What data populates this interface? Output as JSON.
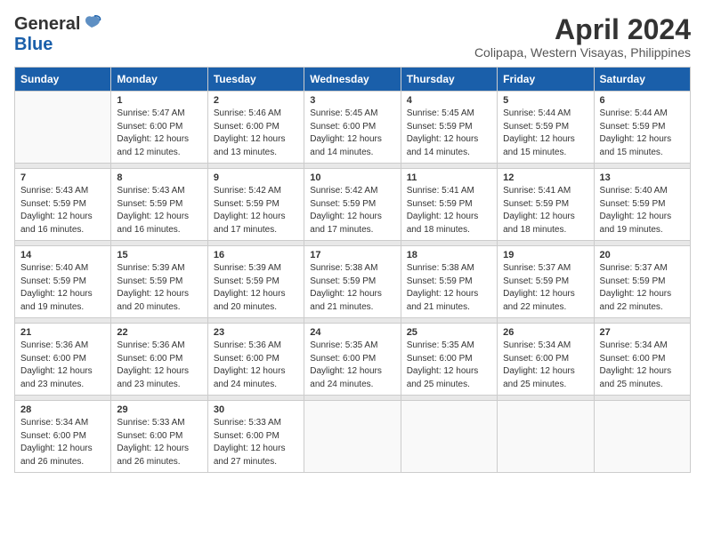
{
  "header": {
    "logo_general": "General",
    "logo_blue": "Blue",
    "title": "April 2024",
    "location": "Colipapa, Western Visayas, Philippines"
  },
  "calendar": {
    "days_of_week": [
      "Sunday",
      "Monday",
      "Tuesday",
      "Wednesday",
      "Thursday",
      "Friday",
      "Saturday"
    ],
    "weeks": [
      [
        {
          "num": "",
          "info": ""
        },
        {
          "num": "1",
          "info": "Sunrise: 5:47 AM\nSunset: 6:00 PM\nDaylight: 12 hours\nand 12 minutes."
        },
        {
          "num": "2",
          "info": "Sunrise: 5:46 AM\nSunset: 6:00 PM\nDaylight: 12 hours\nand 13 minutes."
        },
        {
          "num": "3",
          "info": "Sunrise: 5:45 AM\nSunset: 6:00 PM\nDaylight: 12 hours\nand 14 minutes."
        },
        {
          "num": "4",
          "info": "Sunrise: 5:45 AM\nSunset: 5:59 PM\nDaylight: 12 hours\nand 14 minutes."
        },
        {
          "num": "5",
          "info": "Sunrise: 5:44 AM\nSunset: 5:59 PM\nDaylight: 12 hours\nand 15 minutes."
        },
        {
          "num": "6",
          "info": "Sunrise: 5:44 AM\nSunset: 5:59 PM\nDaylight: 12 hours\nand 15 minutes."
        }
      ],
      [
        {
          "num": "7",
          "info": "Sunrise: 5:43 AM\nSunset: 5:59 PM\nDaylight: 12 hours\nand 16 minutes."
        },
        {
          "num": "8",
          "info": "Sunrise: 5:43 AM\nSunset: 5:59 PM\nDaylight: 12 hours\nand 16 minutes."
        },
        {
          "num": "9",
          "info": "Sunrise: 5:42 AM\nSunset: 5:59 PM\nDaylight: 12 hours\nand 17 minutes."
        },
        {
          "num": "10",
          "info": "Sunrise: 5:42 AM\nSunset: 5:59 PM\nDaylight: 12 hours\nand 17 minutes."
        },
        {
          "num": "11",
          "info": "Sunrise: 5:41 AM\nSunset: 5:59 PM\nDaylight: 12 hours\nand 18 minutes."
        },
        {
          "num": "12",
          "info": "Sunrise: 5:41 AM\nSunset: 5:59 PM\nDaylight: 12 hours\nand 18 minutes."
        },
        {
          "num": "13",
          "info": "Sunrise: 5:40 AM\nSunset: 5:59 PM\nDaylight: 12 hours\nand 19 minutes."
        }
      ],
      [
        {
          "num": "14",
          "info": "Sunrise: 5:40 AM\nSunset: 5:59 PM\nDaylight: 12 hours\nand 19 minutes."
        },
        {
          "num": "15",
          "info": "Sunrise: 5:39 AM\nSunset: 5:59 PM\nDaylight: 12 hours\nand 20 minutes."
        },
        {
          "num": "16",
          "info": "Sunrise: 5:39 AM\nSunset: 5:59 PM\nDaylight: 12 hours\nand 20 minutes."
        },
        {
          "num": "17",
          "info": "Sunrise: 5:38 AM\nSunset: 5:59 PM\nDaylight: 12 hours\nand 21 minutes."
        },
        {
          "num": "18",
          "info": "Sunrise: 5:38 AM\nSunset: 5:59 PM\nDaylight: 12 hours\nand 21 minutes."
        },
        {
          "num": "19",
          "info": "Sunrise: 5:37 AM\nSunset: 5:59 PM\nDaylight: 12 hours\nand 22 minutes."
        },
        {
          "num": "20",
          "info": "Sunrise: 5:37 AM\nSunset: 5:59 PM\nDaylight: 12 hours\nand 22 minutes."
        }
      ],
      [
        {
          "num": "21",
          "info": "Sunrise: 5:36 AM\nSunset: 6:00 PM\nDaylight: 12 hours\nand 23 minutes."
        },
        {
          "num": "22",
          "info": "Sunrise: 5:36 AM\nSunset: 6:00 PM\nDaylight: 12 hours\nand 23 minutes."
        },
        {
          "num": "23",
          "info": "Sunrise: 5:36 AM\nSunset: 6:00 PM\nDaylight: 12 hours\nand 24 minutes."
        },
        {
          "num": "24",
          "info": "Sunrise: 5:35 AM\nSunset: 6:00 PM\nDaylight: 12 hours\nand 24 minutes."
        },
        {
          "num": "25",
          "info": "Sunrise: 5:35 AM\nSunset: 6:00 PM\nDaylight: 12 hours\nand 25 minutes."
        },
        {
          "num": "26",
          "info": "Sunrise: 5:34 AM\nSunset: 6:00 PM\nDaylight: 12 hours\nand 25 minutes."
        },
        {
          "num": "27",
          "info": "Sunrise: 5:34 AM\nSunset: 6:00 PM\nDaylight: 12 hours\nand 25 minutes."
        }
      ],
      [
        {
          "num": "28",
          "info": "Sunrise: 5:34 AM\nSunset: 6:00 PM\nDaylight: 12 hours\nand 26 minutes."
        },
        {
          "num": "29",
          "info": "Sunrise: 5:33 AM\nSunset: 6:00 PM\nDaylight: 12 hours\nand 26 minutes."
        },
        {
          "num": "30",
          "info": "Sunrise: 5:33 AM\nSunset: 6:00 PM\nDaylight: 12 hours\nand 27 minutes."
        },
        {
          "num": "",
          "info": ""
        },
        {
          "num": "",
          "info": ""
        },
        {
          "num": "",
          "info": ""
        },
        {
          "num": "",
          "info": ""
        }
      ]
    ]
  }
}
